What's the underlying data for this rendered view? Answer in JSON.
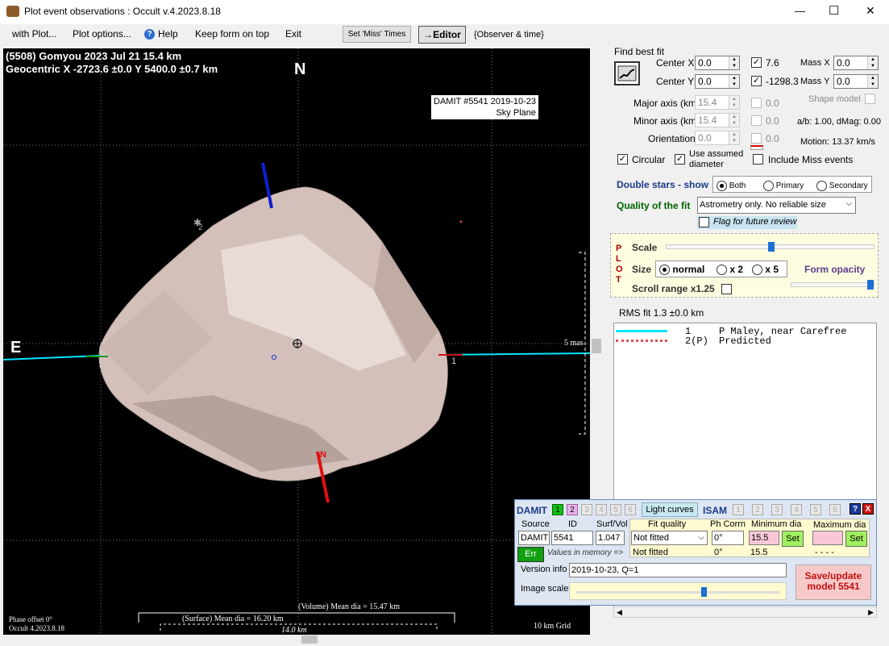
{
  "window": {
    "title": "Plot event observations : Occult v.4.2023.8.18",
    "min": "—",
    "max": "☐",
    "close": "✕"
  },
  "menu": {
    "with_plot": "with Plot...",
    "plot_options": "Plot options...",
    "help": "Help",
    "keep_form": "Keep form on top",
    "exit": "Exit",
    "set_miss": "Set 'Miss' Times",
    "editor": "→Editor",
    "observer_time": "{Observer & time}"
  },
  "plot": {
    "line1": "(5508) Gomyou  2023 Jul 21   15.4 km",
    "line2": "Geocentric  X  -2723.6 ±0.0  Y 5400.0 ±0.7 km",
    "north": "N",
    "east": "E",
    "damit_label": "DAMIT #5541 2019-10-23",
    "sky_plane": "Sky Plane",
    "five_mas": "5 mas",
    "chord1_left": "1",
    "chord1_right": "1",
    "star2": "2",
    "shape_n": "N",
    "volume_dia": "(Volume) Mean dia = 15.47 km",
    "surface_dia": "(Surface) Mean dia = 16.20 km",
    "scale_km": "14.0  km",
    "phase_offset": "Phase offset 0°",
    "occult_ver": "Occult 4.2023.8.18",
    "grid": "10 km Grid"
  },
  "fit": {
    "find_best_fit": "Find best fit",
    "center_x_label": "Center X",
    "center_x": "0.0",
    "center_y_label": "Center Y",
    "center_y": "0.0",
    "major_label": "Major axis (km)",
    "major": "15.4",
    "minor_label": "Minor axis (km)",
    "minor": "15.4",
    "orient_label": "Orientation",
    "orient": "0.0",
    "chk_x_val": "7.6",
    "chk_y_val": "-1298.3",
    "chk_major_val": "0.0",
    "chk_minor_val": "0.0",
    "chk_orient_val": "0.0",
    "mass_x_label": "Mass X",
    "mass_x": "0.0",
    "mass_y_label": "Mass Y",
    "mass_y": "0.0",
    "shape_model": "Shape model",
    "ab": "a/b: 1.00, dMag: 0.00",
    "motion": "Motion: 13.37 km/s",
    "circular": "Circular",
    "use_assumed": "Use assumed",
    "diameter": "diameter",
    "include_miss": "Include Miss events"
  },
  "double": {
    "label": "Double stars - show",
    "both": "Both",
    "primary": "Primary",
    "secondary": "Secondary"
  },
  "quality": {
    "label": "Quality of the fit",
    "value": "Astrometry only. No reliable size",
    "flag": "Flag for future review"
  },
  "plotpanel": {
    "p": "P",
    "l": "L",
    "o": "O",
    "t": "T",
    "scale": "Scale",
    "size": "Size",
    "normal": "normal",
    "x2": "x 2",
    "x5": "x 5",
    "form_opacity": "Form opacity",
    "scroll": "Scroll range x1.25"
  },
  "rms": "RMS fit 1.3 ±0.0 km",
  "legend": [
    {
      "num": "1",
      "name": "P Maley, near Carefree"
    },
    {
      "num": "2(P)",
      "name": "Predicted"
    }
  ],
  "damit": {
    "title": "DAMIT",
    "n1": "1",
    "n2": "2",
    "n3": "3",
    "n4": "4",
    "n5": "5",
    "n6": "6",
    "light_curves": "Light curves",
    "isam": "ISAM",
    "i1": "1",
    "i2": "2",
    "i3": "3",
    "i4": "4",
    "i5": "5",
    "i6": "6",
    "help": "?",
    "close": "X",
    "h_source": "Source",
    "h_id": "ID",
    "h_surf": "Surf/Vol",
    "h_fitq": "Fit quality",
    "h_ph": "Ph Corrn",
    "h_min": "Minimum dia",
    "h_max": "Maximum dia",
    "source": "DAMIT",
    "id": "5541",
    "surf": "1.047",
    "fitq": "Not fitted",
    "ph": "0°",
    "min": "15.5",
    "set": "Set",
    "set2": "Set",
    "err": "Err",
    "values_mem": "Values in memory =>",
    "mem_fitq": "Not fitted",
    "mem_ph": "0°",
    "mem_min": "15.5",
    "mem_max": "- - - -",
    "version_label": "Version info",
    "version": "2019-10-23, Q=1",
    "image_scale": "Image scale",
    "save": "Save/update",
    "save2": "model 5541"
  },
  "colors": {
    "cyan": "#00e5ff",
    "blue": "#1020d0",
    "red": "#e01010",
    "accent_green": "#006400",
    "damit_blue": "#1a3a8a"
  }
}
